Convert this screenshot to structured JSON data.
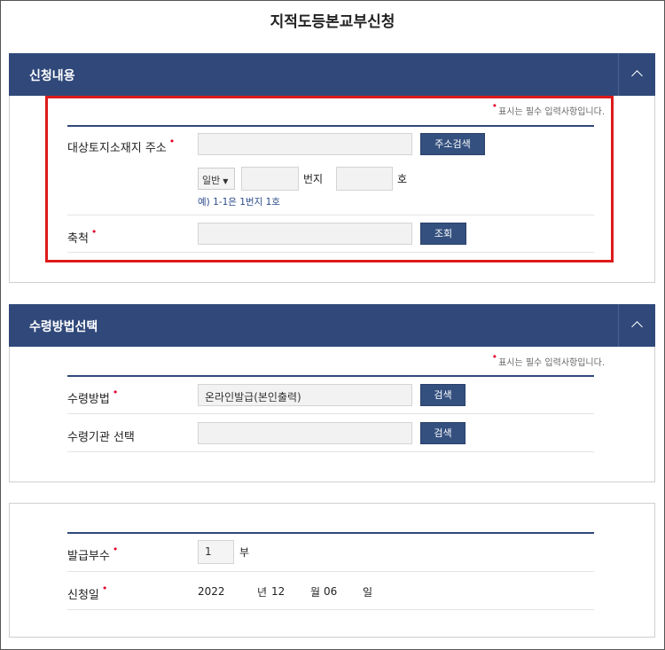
{
  "page_title": "지적도등본교부신청",
  "required_note": "표시는 필수 입력사항입니다.",
  "section1": {
    "title": "신청내용",
    "address_label": "대상토지소재지 주소",
    "address_value": "",
    "address_search_button": "주소검색",
    "lot_type_value": "일반",
    "lot_unit": "번지",
    "sub_unit": "호",
    "example": "예) 1-1은 1번지 1호",
    "scale_label": "축척",
    "scale_button": "조회"
  },
  "section2": {
    "title": "수령방법선택",
    "method_label": "수령방법",
    "method_value": "온라인발급(본인출력)",
    "method_button": "검색",
    "agency_label": "수령기관 선택",
    "agency_button": "검색"
  },
  "section3": {
    "copies_label": "발급부수",
    "copies_value": "1",
    "copies_unit": "부",
    "date_label": "신청일",
    "year": "2022",
    "year_unit": "년",
    "month": "12",
    "month_unit": "월",
    "day": "06",
    "day_unit": "일"
  }
}
